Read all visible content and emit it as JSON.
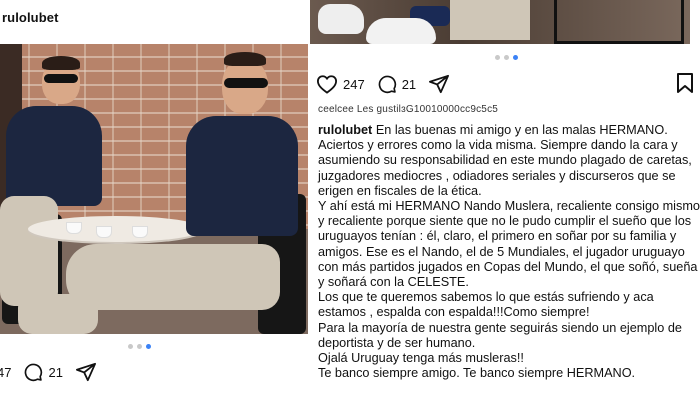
{
  "left_post": {
    "username": "rulolubet",
    "comments_count": "21",
    "likes_count_visible": "47",
    "carousel": {
      "total": 3,
      "active": 3
    }
  },
  "right_post": {
    "likes_count": "247",
    "comments_count": "21",
    "carousel": {
      "total": 3,
      "active": 3
    },
    "likes_line": "ceelcee Les gustilɜG10010000cc9c5c5",
    "caption_username": "rulolubet",
    "caption_paragraphs": [
      "En las buenas mi amigo y en las malas HERMANO. Aciertos y errores como la vida misma. Siempre dando la cara y asumiendo su responsabilidad en este mundo plagado de caretas, juzgadores mediocres , odiadores seriales y discurseros que se erigen en fiscales de la ética.",
      "Y ahí está mi HERMANO Nando Muslera, recaliente consigo mismo y recaliente porque siente que no le pudo cumplir el sueño que los uruguayos tenían : él, claro, el primero en soñar por su familia y amigos. Ese es el Nando, el de 5 Mundiales, el jugador uruguayo con más partidos jugados en Copas del Mundo, el que soñó, sueña y soñará con la CELESTE.",
      "Los que te queremos sabemos lo que estás sufriendo y aca estamos , espalda con espalda!!!Como siempre!",
      "Para la mayoría de nuestra gente seguirás siendo un ejemplo de deportista y de ser humano.",
      "Ojalá Uruguay tenga más musleras!!",
      "Te banco siempre amigo. Te banco siempre HERMANO."
    ]
  },
  "icons": {
    "like": "heart-icon",
    "comment": "comment-icon",
    "share": "paper-plane-icon",
    "save": "bookmark-icon"
  }
}
